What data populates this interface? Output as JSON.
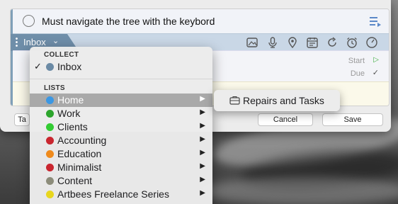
{
  "task": {
    "title": "Must navigate the tree with the keybord",
    "project": "Inbox"
  },
  "meta": {
    "start_label": "Start",
    "due_label": "Due"
  },
  "footer": {
    "left_button": "Ta",
    "cancel": "Cancel",
    "save": "Save"
  },
  "menu": {
    "collect_header": "COLLECT",
    "collect_item": {
      "label": "Inbox",
      "color": "#6b8aa5",
      "checked": true
    },
    "lists_header": "LISTS",
    "lists": [
      {
        "label": "Home",
        "color": "#3b97e3",
        "highlighted": true
      },
      {
        "label": "Work",
        "color": "#2da52d"
      },
      {
        "label": "Clients",
        "color": "#33cc33"
      },
      {
        "label": "Accounting",
        "color": "#c9262f"
      },
      {
        "label": "Education",
        "color": "#ef8a1c"
      },
      {
        "label": "Minimalist",
        "color": "#c9262f"
      },
      {
        "label": "Content",
        "color": "#8c8c7a"
      },
      {
        "label": "Artbees Freelance Series",
        "color": "#e8d61e"
      }
    ]
  },
  "submenu": {
    "label": "Repairs and Tasks"
  }
}
